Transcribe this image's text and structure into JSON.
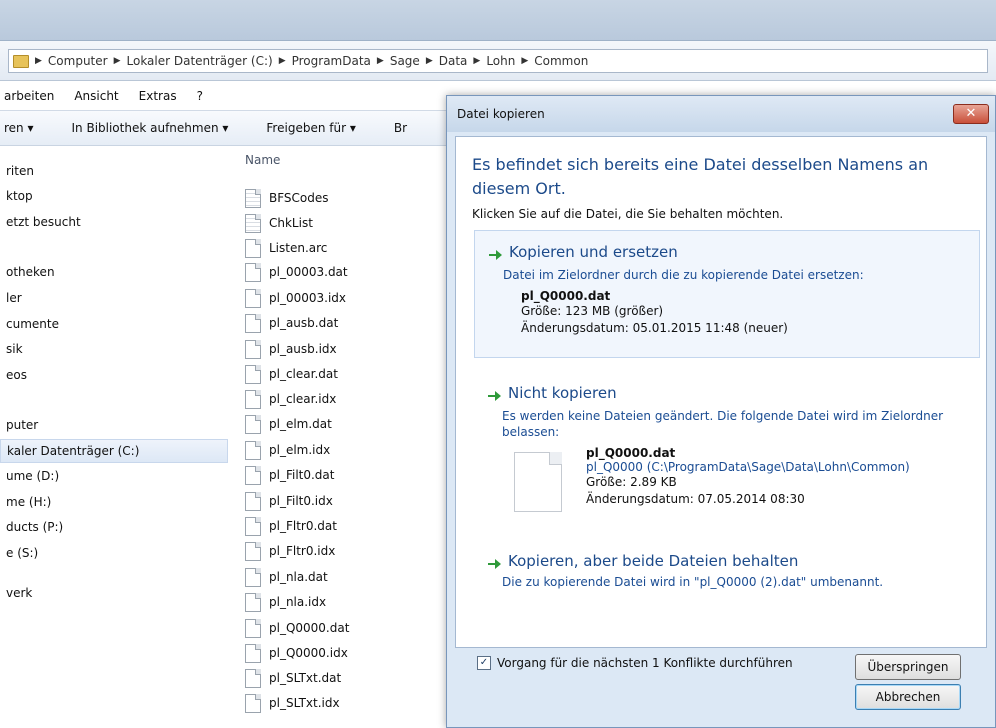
{
  "addressbar": {
    "crumbs": [
      "Computer",
      "Lokaler Datenträger (C:)",
      "ProgramData",
      "Sage",
      "Data",
      "Lohn",
      "Common"
    ]
  },
  "menubar": [
    "arbeiten",
    "Ansicht",
    "Extras",
    "?"
  ],
  "toolbar": [
    "ren ▾",
    "In Bibliothek aufnehmen ▾",
    "Freigeben für ▾",
    "Br"
  ],
  "nav": [
    "riten",
    "ktop",
    "etzt besucht",
    "otheken",
    "ler",
    "cumente",
    "sik",
    "eos",
    "puter",
    "kaler Datenträger (C:)",
    "ume (D:)",
    "me (H:)",
    "ducts (P:)",
    "e (S:)",
    "verk"
  ],
  "filelist": {
    "column_header": "Name",
    "files": [
      "BFSCodes",
      "ChkList",
      "Listen.arc",
      "pl_00003.dat",
      "pl_00003.idx",
      "pl_ausb.dat",
      "pl_ausb.idx",
      "pl_clear.dat",
      "pl_clear.idx",
      "pl_elm.dat",
      "pl_elm.idx",
      "pl_Filt0.dat",
      "pl_Filt0.idx",
      "pl_Fltr0.dat",
      "pl_Fltr0.idx",
      "pl_nla.dat",
      "pl_nla.idx",
      "pl_Q0000.dat",
      "pl_Q0000.idx",
      "pl_SLTxt.dat",
      "pl_SLTxt.idx"
    ]
  },
  "dialog": {
    "title": "Datei kopieren",
    "close_label": "✕",
    "headline": "Es befindet sich bereits eine Datei desselben Namens an diesem Ort.",
    "subline": "Klicken Sie auf die Datei, die Sie behalten möchten.",
    "option_replace": {
      "title": "Kopieren und ersetzen",
      "desc": "Datei im Zielordner durch die zu kopierende Datei ersetzen:",
      "filename": "pl_Q0000.dat",
      "size": "Größe: 123 MB (größer)",
      "date": "Änderungsdatum: 05.01.2015 11:48 (neuer)"
    },
    "option_skip": {
      "title": "Nicht kopieren",
      "desc": "Es werden keine Dateien geändert. Die folgende Datei wird im Zielordner belassen:",
      "filename": "pl_Q0000.dat",
      "path": "pl_Q0000 (C:\\ProgramData\\Sage\\Data\\Lohn\\Common)",
      "size": "Größe: 2.89 KB",
      "date": "Änderungsdatum: 07.05.2014 08:30"
    },
    "option_both": {
      "title": "Kopieren, aber beide Dateien behalten",
      "desc": "Die zu kopierende Datei wird in \"pl_Q0000 (2).dat\" umbenannt."
    },
    "checkbox_label": "Vorgang für die nächsten 1 Konflikte durchführen",
    "checkbox_mark": "✓",
    "skip_button": "Überspringen",
    "cancel_button": "Abbrechen"
  }
}
